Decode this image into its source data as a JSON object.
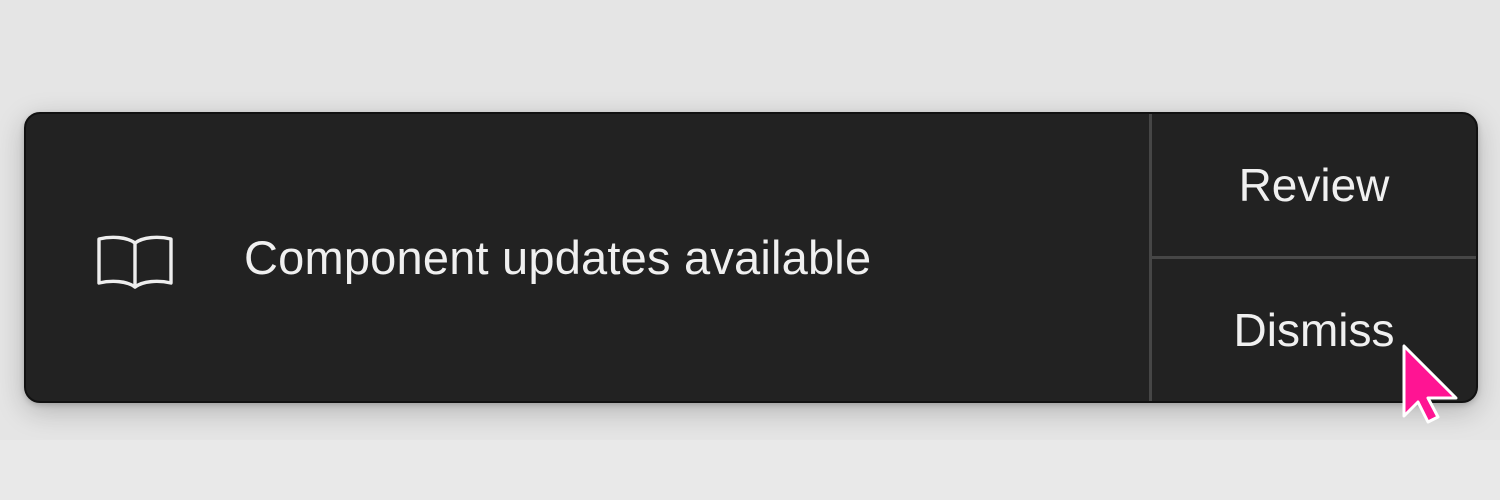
{
  "toast": {
    "icon": "book-open-icon",
    "message": "Component updates available",
    "actions": {
      "review_label": "Review",
      "dismiss_label": "Dismiss"
    }
  },
  "cursor": {
    "icon": "mouse-pointer-icon",
    "color": "#ff1493"
  },
  "colors": {
    "toast_background": "#222222",
    "text": "#f0f0f0",
    "divider": "#464646",
    "page_background": "#e5e5e5"
  }
}
